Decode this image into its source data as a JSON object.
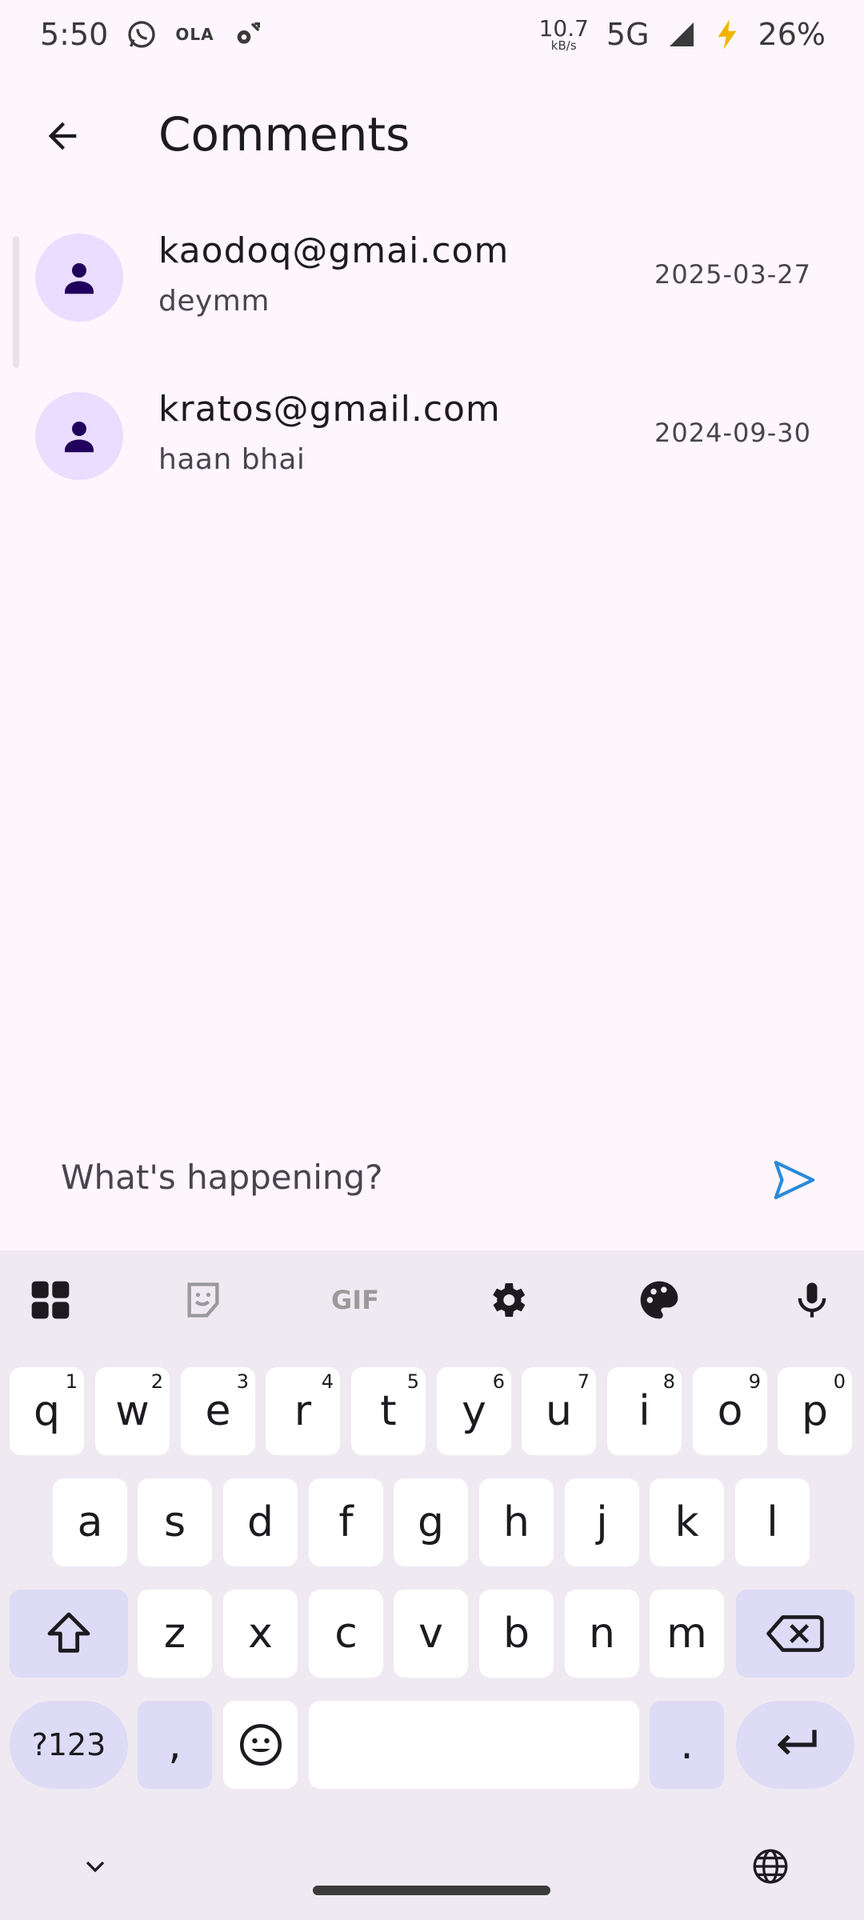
{
  "status_bar": {
    "time": "5:50",
    "ola_label": "OLA",
    "speed_value": "10.7",
    "speed_unit": "kB/s",
    "network": "5G",
    "battery": "26%"
  },
  "header": {
    "title": "Comments"
  },
  "comments": [
    {
      "email": "kaodoq@gmai.com",
      "text": "deymm",
      "date": "2025-03-27"
    },
    {
      "email": "kratos@gmail.com",
      "text": "haan bhai",
      "date": "2024-09-30"
    }
  ],
  "input": {
    "placeholder": "What's happening?"
  },
  "keyboard": {
    "toolbar": {
      "gif_label": "GIF"
    },
    "row1": [
      {
        "key": "q",
        "hint": "1"
      },
      {
        "key": "w",
        "hint": "2"
      },
      {
        "key": "e",
        "hint": "3"
      },
      {
        "key": "r",
        "hint": "4"
      },
      {
        "key": "t",
        "hint": "5"
      },
      {
        "key": "y",
        "hint": "6"
      },
      {
        "key": "u",
        "hint": "7"
      },
      {
        "key": "i",
        "hint": "8"
      },
      {
        "key": "o",
        "hint": "9"
      },
      {
        "key": "p",
        "hint": "0"
      }
    ],
    "row2": [
      "a",
      "s",
      "d",
      "f",
      "g",
      "h",
      "j",
      "k",
      "l"
    ],
    "row3": [
      "z",
      "x",
      "c",
      "v",
      "b",
      "n",
      "m"
    ],
    "symbols_label": "?123",
    "comma_label": ",",
    "period_label": "."
  },
  "colors": {
    "background": "#fdf6fc",
    "avatar_bg": "#eaddff",
    "avatar_icon": "#21005d",
    "send_icon": "#2b8ad8",
    "keyboard_bg": "#efeaf2",
    "key_modifier": "#dddbf5"
  },
  "icons": {
    "back": "arrow-back-icon",
    "avatar": "person-icon",
    "send": "send-icon"
  }
}
